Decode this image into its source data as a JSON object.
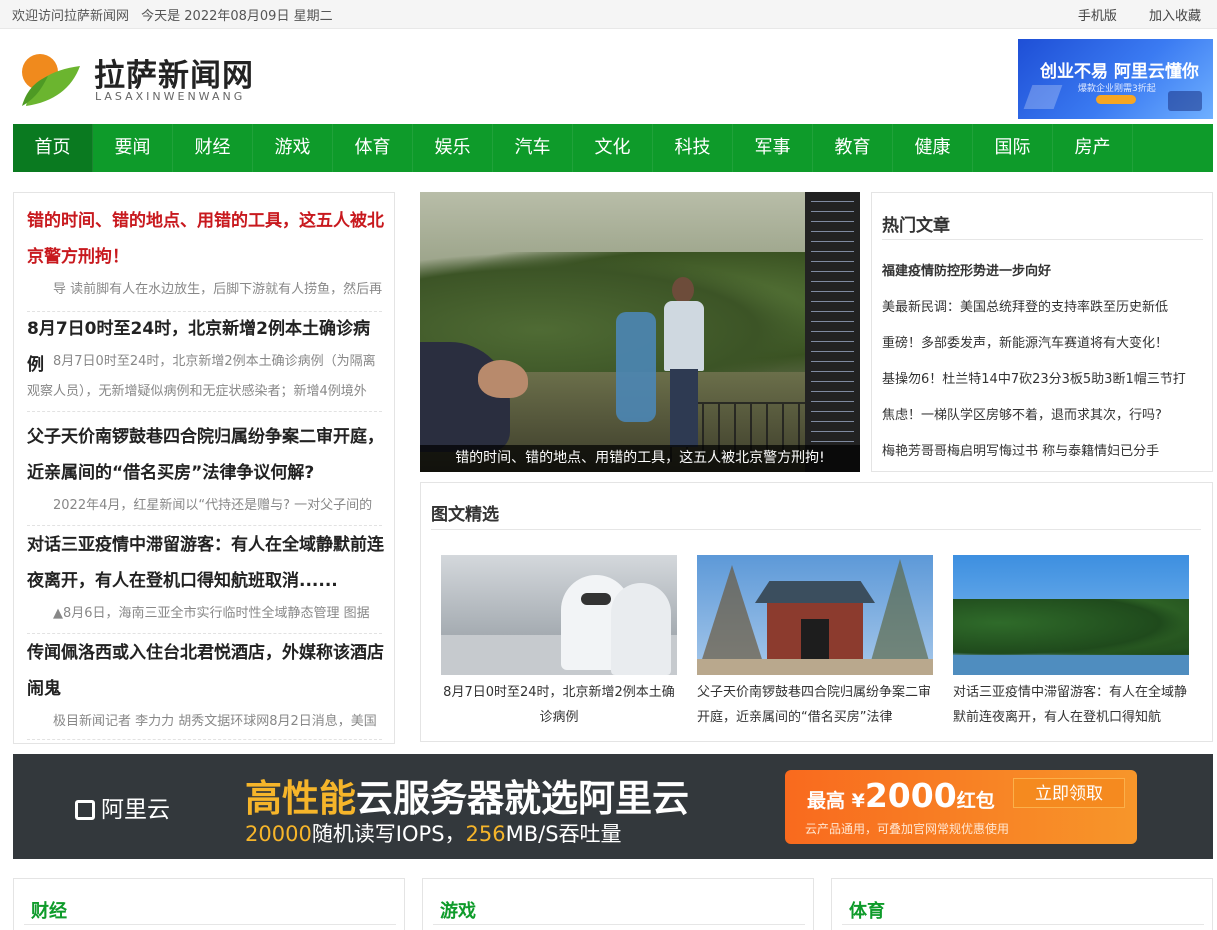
{
  "topbar": {
    "welcome": "欢迎访问拉萨新闻网",
    "date": "今天是 2022年08月09日 星期二",
    "mobile": "手机版",
    "favorite": "加入收藏"
  },
  "logo": {
    "title": "拉萨新闻网",
    "subtitle": "LASAXINWENWANG"
  },
  "header_ad": {
    "headline": "创业不易 阿里云懂你",
    "subline": "爆款企业刚需3折起"
  },
  "nav": [
    "首页",
    "要闻",
    "财经",
    "游戏",
    "体育",
    "娱乐",
    "汽车",
    "文化",
    "科技",
    "军事",
    "教育",
    "健康",
    "国际",
    "房产"
  ],
  "left_news": [
    {
      "title": "错的时间、错的地点、用错的工具，这五人被北京警方刑拘！",
      "summary": "导 读前脚有人在水边放生，后脚下游就有人捞鱼，然后再"
    },
    {
      "title": "8月7日0时至24时，北京新增2例本土确诊病例",
      "summary": "8月7日0时至24时，北京新增2例本土确诊病例（为隔离观察人员），无新增疑似病例和无症状感染者；新增4例境外"
    },
    {
      "title": "父子天价南锣鼓巷四合院归属纷争案二审开庭，近亲属间的“借名买房”法律争议何解?",
      "summary": "2022年4月，红星新闻以“代持还是赠与? 一对父子间的"
    },
    {
      "title": "对话三亚疫情中滞留游客：有人在全域静默前连夜离开，有人在登机口得知航班取消......",
      "summary": "▲8月6日，海南三亚全市实行临时性全域静态管理 图据"
    },
    {
      "title": "传闻佩洛西或入住台北君悦酒店，外媒称该酒店闹鬼",
      "summary": "极目新闻记者 李力力 胡秀文据环球网8月2日消息，美国"
    }
  ],
  "main_caption": "错的时间、错的地点、用错的工具，这五人被北京警方刑拘!",
  "hot": {
    "heading": "热门文章",
    "items": [
      "福建疫情防控形势进一步向好",
      "美最新民调：美国总统拜登的支持率跌至历史新低",
      "重磅！多部委发声，新能源汽车赛道将有大变化！",
      "基操勿6！杜兰特14中7砍23分3板5助3断1帽三节打",
      "焦虑！一梯队学区房够不着，退而求其次，行吗?",
      "梅艳芳哥哥梅启明写悔过书 称与泰籍情妇已分手"
    ]
  },
  "picks": {
    "heading": "图文精选",
    "items": [
      {
        "caption": "8月7日0时至24时，北京新增2例本土确诊病例"
      },
      {
        "caption": "父子天价南锣鼓巷四合院归属纷争案二审开庭，近亲属间的“借名买房”法律"
      },
      {
        "caption": "对话三亚疫情中滞留游客：有人在全域静默前连夜离开，有人在登机口得知航"
      }
    ]
  },
  "big_ad": {
    "brand": "阿里云",
    "headline_hi": "高性能",
    "headline_rest": "云服务器就选阿里云",
    "line2_a": "20000",
    "line2_b": "随机读写IOPS，",
    "line2_c": "256",
    "line2_d": "MB/S吞吐量",
    "coupon_prefix": "最高 ¥",
    "coupon_amount": "2000",
    "coupon_suffix": "红包",
    "coupon_button": "立即领取",
    "coupon_note": "云产品通用，可叠加官网常规优惠使用"
  },
  "sections": [
    "财经",
    "游戏",
    "体育"
  ],
  "colors": {
    "nav_green": "#0e9b2a",
    "nav_active": "#0a7a20",
    "headline_red": "#c8191e",
    "ad_orange": "#f6b52a"
  }
}
